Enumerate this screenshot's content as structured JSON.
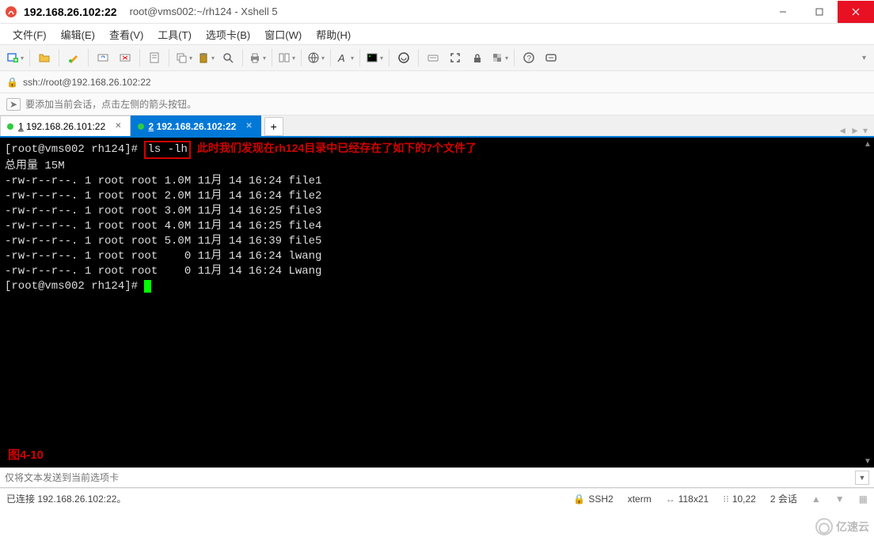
{
  "titlebar": {
    "ip": "192.168.26.102:22",
    "title": "root@vms002:~/rh124 - Xshell 5"
  },
  "menus": [
    "文件(F)",
    "编辑(E)",
    "查看(V)",
    "工具(T)",
    "选项卡(B)",
    "窗口(W)",
    "帮助(H)"
  ],
  "address": {
    "url": "ssh://root@192.168.26.102:22"
  },
  "hint": "要添加当前会话，点击左侧的箭头按钮。",
  "tabs": [
    {
      "num": "1",
      "label": "192.168.26.101:22",
      "active": false
    },
    {
      "num": "2",
      "label": "192.168.26.102:22",
      "active": true
    }
  ],
  "terminal": {
    "prompt": "[root@vms002 rh124]#",
    "command": "ls -lh",
    "annotation": "此时我们发现在rh124目录中已经存在了如下的7个文件了",
    "total_line": "总用量 15M",
    "files": [
      "-rw-r--r--. 1 root root 1.0M 11月 14 16:24 file1",
      "-rw-r--r--. 1 root root 2.0M 11月 14 16:24 file2",
      "-rw-r--r--. 1 root root 3.0M 11月 14 16:25 file3",
      "-rw-r--r--. 1 root root 4.0M 11月 14 16:25 file4",
      "-rw-r--r--. 1 root root 5.0M 11月 14 16:39 file5",
      "-rw-r--r--. 1 root root    0 11月 14 16:24 lwang",
      "-rw-r--r--. 1 root root    0 11月 14 16:24 Lwang"
    ],
    "figure_label": "图4-10"
  },
  "inputbar": {
    "placeholder": "仅将文本发送到当前选项卡"
  },
  "statusbar": {
    "connection": "已连接 192.168.26.102:22。",
    "protocol_label": "SSH2",
    "termtype": "xterm",
    "size": "118x21",
    "cursor": "10,22",
    "sessions": "2 会话"
  },
  "watermark": "亿速云"
}
